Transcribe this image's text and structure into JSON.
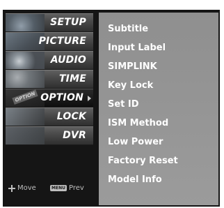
{
  "main_menu": {
    "items": [
      {
        "label": "SETUP",
        "icon": "satellite-dish-icon",
        "active": false
      },
      {
        "label": "PICTURE",
        "icon": "film-reel-icon",
        "active": false
      },
      {
        "label": "AUDIO",
        "icon": "speaker-icon",
        "active": false
      },
      {
        "label": "TIME",
        "icon": "clock-icon",
        "active": false
      },
      {
        "label": "OPTION",
        "icon": "option-tag-icon",
        "active": true
      },
      {
        "label": "LOCK",
        "icon": "padlock-icon",
        "active": false
      },
      {
        "label": "DVR",
        "icon": "recorder-icon",
        "active": false
      }
    ],
    "option_tag_text": "OPTION"
  },
  "footer": {
    "move_label": "Move",
    "menu_key_label": "MENU",
    "prev_label": "Prev"
  },
  "option_submenu": {
    "items": [
      "Subtitle",
      "Input Label",
      "SIMPLINK",
      "Key Lock",
      "Set ID",
      "ISM Method",
      "Low Power",
      "Factory Reset",
      "Model Info"
    ]
  },
  "colors": {
    "panel_background": "#151515",
    "submenu_background": "#959595",
    "text": "#ffffff"
  }
}
